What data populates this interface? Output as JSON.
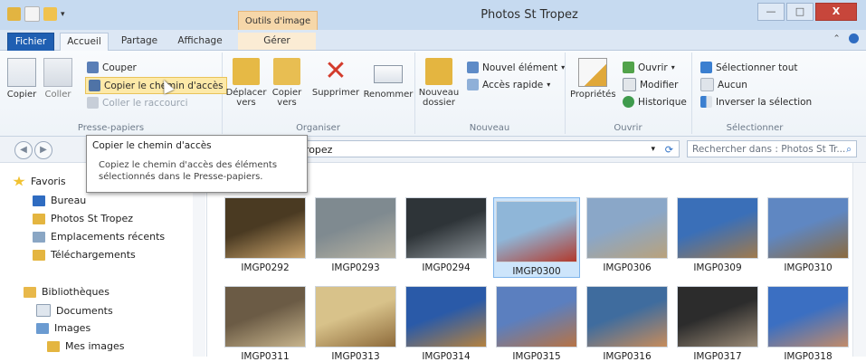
{
  "window": {
    "title": "Photos St Tropez",
    "context_tab": "Outils d'image",
    "controls": [
      "—",
      "□",
      "X"
    ]
  },
  "ribbon_tabs": {
    "file": "Fichier",
    "home": "Accueil",
    "share": "Partage",
    "view": "Affichage",
    "manage": "Gérer"
  },
  "ribbon": {
    "clipboard": {
      "label": "Presse-papiers",
      "copy": "Copier",
      "paste": "Coller",
      "cut": "Couper",
      "copy_path": "Copier le chemin d'accès",
      "paste_shortcut": "Coller le raccourci"
    },
    "organize": {
      "label": "Organiser",
      "move_to": "Déplacer vers",
      "copy_to": "Copier vers",
      "delete": "Supprimer",
      "rename": "Renommer"
    },
    "new": {
      "label": "Nouveau",
      "new_folder": "Nouveau dossier",
      "new_item": "Nouvel élément",
      "easy_access": "Accès rapide"
    },
    "open": {
      "label": "Ouvrir",
      "properties": "Propriétés",
      "open": "Ouvrir",
      "edit": "Modifier",
      "history": "Historique"
    },
    "select": {
      "label": "Sélectionner",
      "select_all": "Sélectionner tout",
      "select_none": "Aucun",
      "invert": "Inverser la sélection"
    }
  },
  "address": {
    "path": "t Tropez",
    "search_placeholder": "Rechercher dans : Photos St Tr..."
  },
  "tooltip": {
    "title": "Copier le chemin d'accès",
    "body": "Copiez le chemin d'accès des éléments sélectionnés dans le Presse-papiers."
  },
  "nav": {
    "favorites": "Favoris",
    "desktop": "Bureau",
    "photos": "Photos St Tropez",
    "recent": "Emplacements récents",
    "downloads": "Téléchargements",
    "libraries": "Bibliothèques",
    "documents": "Documents",
    "images": "Images",
    "my_images": "Mes images"
  },
  "files": [
    {
      "name": "IMGP0292",
      "colors": [
        "#4a3a22",
        "#c9a36b"
      ],
      "selected": false
    },
    {
      "name": "IMGP0293",
      "colors": [
        "#7f8a90",
        "#b8b3a2"
      ],
      "selected": false
    },
    {
      "name": "IMGP0294",
      "colors": [
        "#2e3438",
        "#8c9398"
      ],
      "selected": false
    },
    {
      "name": "IMGP0300",
      "colors": [
        "#8fb6d8",
        "#b23a2d"
      ],
      "selected": true
    },
    {
      "name": "IMGP0306",
      "colors": [
        "#8aa7c8",
        "#b9a27c"
      ],
      "selected": false
    },
    {
      "name": "IMGP0309",
      "colors": [
        "#3a6fb8",
        "#a07a4c"
      ],
      "selected": false
    },
    {
      "name": "IMGP0310",
      "colors": [
        "#5f87c2",
        "#8b6a3e"
      ],
      "selected": false
    },
    {
      "name": "IMGP0311",
      "colors": [
        "#6b5b45",
        "#c7b48c"
      ],
      "selected": false
    },
    {
      "name": "IMGP0313",
      "colors": [
        "#d8c28a",
        "#8e6b3b"
      ],
      "selected": false
    },
    {
      "name": "IMGP0314",
      "colors": [
        "#2a5aa8",
        "#b5823f"
      ],
      "selected": false
    },
    {
      "name": "IMGP0315",
      "colors": [
        "#5b7fbf",
        "#b77345"
      ],
      "selected": false
    },
    {
      "name": "IMGP0316",
      "colors": [
        "#3f6c9e",
        "#c78c5b"
      ],
      "selected": false
    },
    {
      "name": "IMGP0317",
      "colors": [
        "#2c2c2c",
        "#9a8a76"
      ],
      "selected": false
    },
    {
      "name": "IMGP0318",
      "colors": [
        "#3b6fc2",
        "#c28b6a"
      ],
      "selected": false
    }
  ],
  "colors": {
    "accent": "#1f5fb2",
    "context_tab": "#f6d7a9",
    "selection": "#cde5fb"
  }
}
